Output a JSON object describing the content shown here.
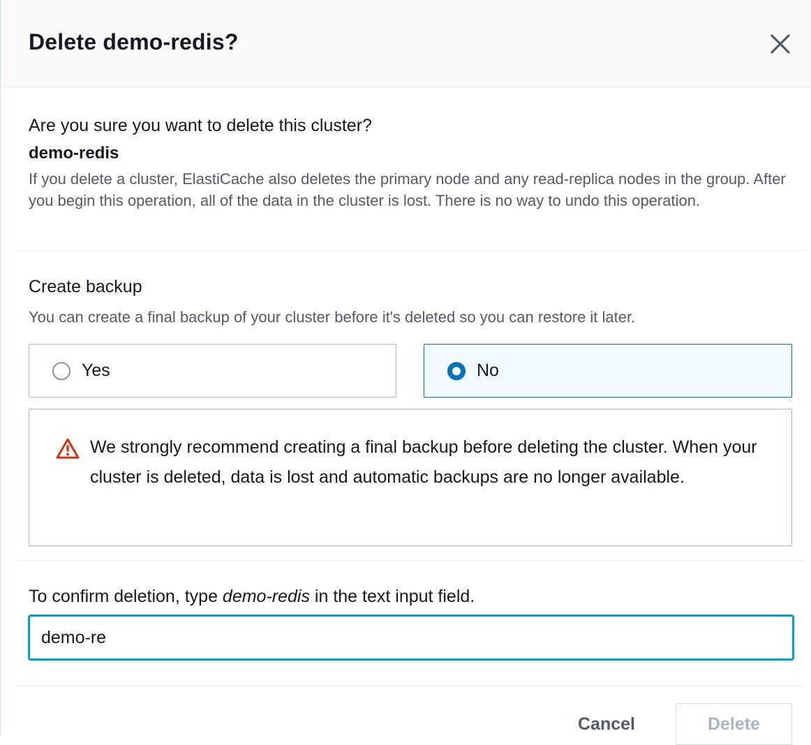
{
  "header": {
    "title": "Delete demo-redis?"
  },
  "confirmation": {
    "question": "Are you sure you want to delete this cluster?",
    "cluster_name": "demo-redis",
    "description": "If you delete a cluster, ElastiCache also deletes the primary node and any read-replica nodes in the group. After you begin this operation, all of the data in the cluster is lost. There is no way to undo this operation."
  },
  "backup": {
    "label": "Create backup",
    "description": "You can create a final backup of your cluster before it's deleted so you can restore it later.",
    "options": [
      {
        "label": "Yes",
        "selected": false
      },
      {
        "label": "No",
        "selected": true
      }
    ],
    "alert_text": "We strongly recommend creating a final backup before deleting the cluster. When your cluster is deleted, data is lost and automatic backups are no longer available."
  },
  "confirm_input": {
    "label_prefix": "To confirm deletion, type ",
    "label_emphasis": "demo-redis",
    "label_suffix": " in the text input field.",
    "value": "demo-re"
  },
  "footer": {
    "cancel_label": "Cancel",
    "delete_label": "Delete"
  },
  "colors": {
    "primary_blue": "#0073bb",
    "focus_ring": "#00a1c9",
    "warning_red": "#d13212",
    "secondary_text": "#545b64"
  },
  "icons": {
    "close": "close-icon",
    "warning": "warning-icon"
  }
}
